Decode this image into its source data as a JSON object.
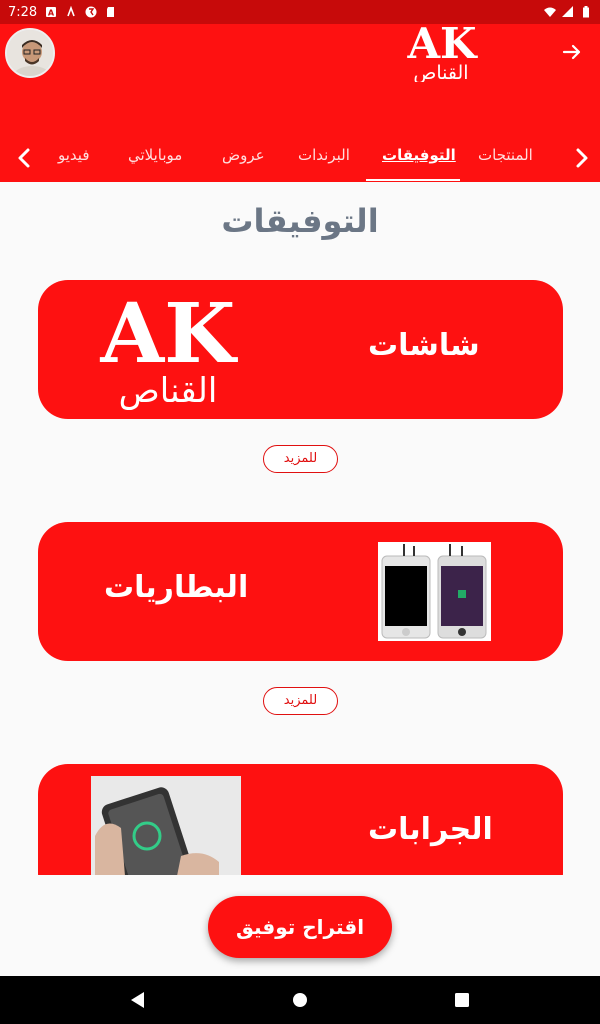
{
  "status_bar": {
    "time": "7:28"
  },
  "header": {
    "logo_text": "AK",
    "logo_arabic": "القناص",
    "tabs": [
      {
        "label": "المنتجات"
      },
      {
        "label": "التوفيقات"
      },
      {
        "label": "البرندات"
      },
      {
        "label": "عروض"
      },
      {
        "label": "موبايلاتي"
      },
      {
        "label": "فيديو"
      }
    ],
    "active_tab": "التوفيقات"
  },
  "main": {
    "title": "التوفيقات",
    "cards": [
      {
        "label": "شاشات",
        "more_label": "للمزيد",
        "image": "ak-logo"
      },
      {
        "label": "البطاريات",
        "more_label": "للمزيد",
        "image": "phone-screens"
      },
      {
        "label": "الجرابات",
        "image": "phone-in-hand"
      }
    ]
  },
  "fab": {
    "label": "اقتراح توفيق"
  },
  "colors": {
    "primary": "#fe1111",
    "status_bar": "#c70a0a",
    "title_gray": "#6b7685"
  }
}
